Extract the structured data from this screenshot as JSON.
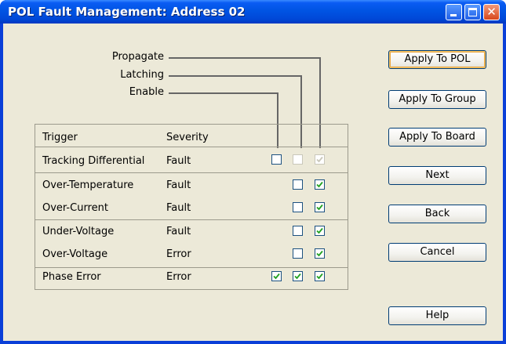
{
  "window": {
    "title": "POL Fault Management: Address 02"
  },
  "legend": {
    "propagate": "Propagate",
    "latching": "Latching",
    "enable": "Enable"
  },
  "table": {
    "header_trigger": "Trigger",
    "header_severity": "Severity",
    "rows": [
      {
        "trigger": "Tracking Differential",
        "severity": "Fault",
        "enable": false,
        "latching": false,
        "propagate": true,
        "latching_disabled": true,
        "propagate_disabled": true
      },
      {
        "trigger": "Over-Temperature",
        "severity": "Fault",
        "enable": null,
        "latching": false,
        "propagate": true
      },
      {
        "trigger": "Over-Current",
        "severity": "Fault",
        "enable": null,
        "latching": false,
        "propagate": true
      },
      {
        "trigger": "Under-Voltage",
        "severity": "Fault",
        "enable": null,
        "latching": false,
        "propagate": true
      },
      {
        "trigger": "Over-Voltage",
        "severity": "Error",
        "enable": null,
        "latching": false,
        "propagate": true
      },
      {
        "trigger": "Phase Error",
        "severity": "Error",
        "enable": true,
        "latching": true,
        "propagate": true
      }
    ]
  },
  "buttons": {
    "apply_to_pol": "Apply To POL",
    "apply_to_group": "Apply To Group",
    "apply_to_board": "Apply To Board",
    "next": "Next",
    "back": "Back",
    "cancel": "Cancel",
    "help": "Help"
  },
  "colors": {
    "titlebar": "#0054e3",
    "dialog_bg": "#ece9d8",
    "check_green": "#21a121"
  }
}
